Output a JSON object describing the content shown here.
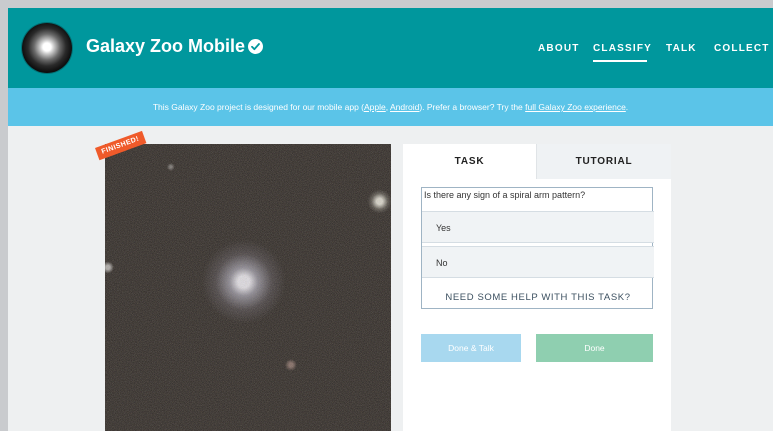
{
  "header": {
    "title": "Galaxy Zoo Mobile",
    "nav": [
      {
        "label": "ABOUT"
      },
      {
        "label": "CLASSIFY",
        "active": true
      },
      {
        "label": "TALK"
      },
      {
        "label": "COLLECT"
      }
    ]
  },
  "banner": {
    "text_before": "This Galaxy Zoo project is designed for our mobile app (",
    "link_apple": "Apple",
    "sep": ", ",
    "link_android": "Android",
    "text_middle": "). Prefer a browser? Try the ",
    "link_full": "full Galaxy Zoo experience",
    "text_after": "."
  },
  "subject": {
    "badge": "FINISHED!"
  },
  "panel": {
    "tabs": [
      {
        "label": "TASK",
        "active": true
      },
      {
        "label": "TUTORIAL"
      }
    ],
    "question": "Is there any sign of a spiral arm pattern?",
    "answers": [
      {
        "label": "Yes"
      },
      {
        "label": "No"
      }
    ],
    "help": "NEED SOME HELP WITH THIS TASK?",
    "buttons": {
      "done_talk": "Done & Talk",
      "done": "Done"
    }
  },
  "colors": {
    "header": "#00979d",
    "banner": "#5bc4e8",
    "badge": "#ef5a2a",
    "done_talk": "#a8d8ef",
    "done": "#8fcfb0"
  }
}
